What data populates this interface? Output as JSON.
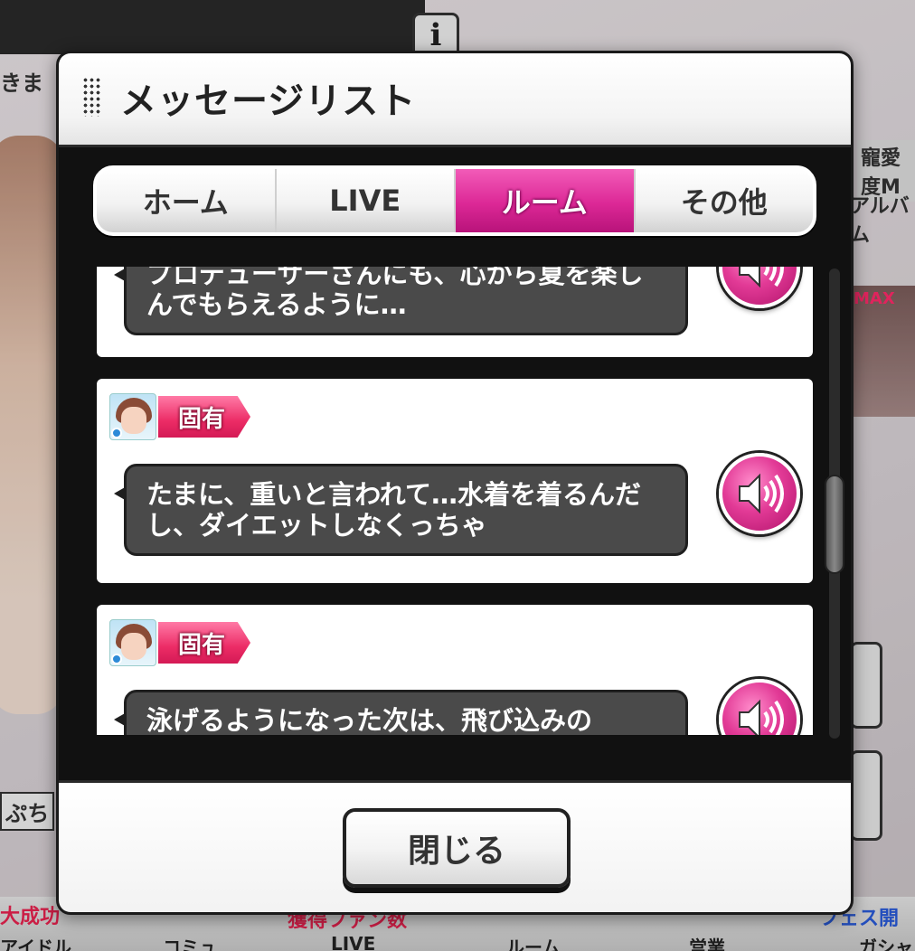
{
  "background": {
    "info_button": "i",
    "text_left_top": "きま",
    "text_right_1": "寵愛度M",
    "text_right_2": "アルバム",
    "text_right_max": "MAX",
    "text_left_bottom": "ぷち",
    "bottom_left_badge": "大成功",
    "bottom_mid_badge": "獲得ファン数",
    "bottom_right_badge": "フェス開",
    "bottom_nav": [
      "アイドル",
      "コミュ",
      "LIVE",
      "ルーム",
      "営業",
      "ガシャ"
    ]
  },
  "modal": {
    "title": "メッセージリスト",
    "tabs": [
      {
        "label": "ホーム",
        "active": false
      },
      {
        "label": "LIVE",
        "active": false
      },
      {
        "label": "ルーム",
        "active": true
      },
      {
        "label": "その他",
        "active": false
      }
    ],
    "messages": [
      {
        "tag": "",
        "text": "プロデューサーさんにも、心から夏を楽しんでもらえるように…"
      },
      {
        "tag": "固有",
        "text": "たまに、重いと言われて…水着を着るんだし、ダイエットしなくっちゃ"
      },
      {
        "tag": "固有",
        "text": "泳げるようになった次は、飛び込みの"
      }
    ],
    "close_label": "閉じる"
  },
  "colors": {
    "accent_pink": "#dc2896",
    "tag_pink": "#ec2c66",
    "bubble_bg": "#4a4a4a"
  }
}
